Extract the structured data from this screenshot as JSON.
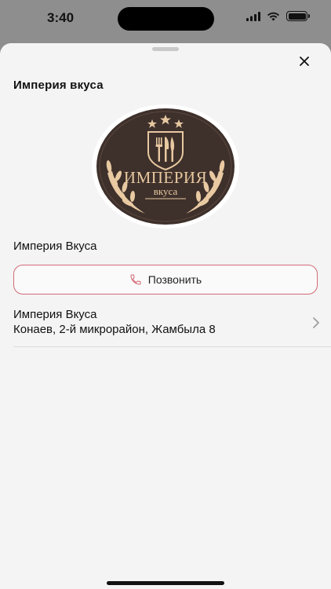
{
  "status_bar": {
    "time": "3:40"
  },
  "sheet": {
    "title": "Империя вкуса",
    "logo": {
      "line1": "ИМПЕРИЯ",
      "line2": "вкуса",
      "colors": {
        "bg": "#3e302b",
        "accent": "#e8c9a1"
      }
    },
    "restaurant_name": "Империя Вкуса",
    "call_button": {
      "label": "Позвонить",
      "icon": "phone-icon",
      "accent": "#d26a78"
    },
    "location": {
      "title": "Империя Вкуса",
      "address": "Конаев, 2-й микрорайон, Жамбыла 8"
    }
  }
}
